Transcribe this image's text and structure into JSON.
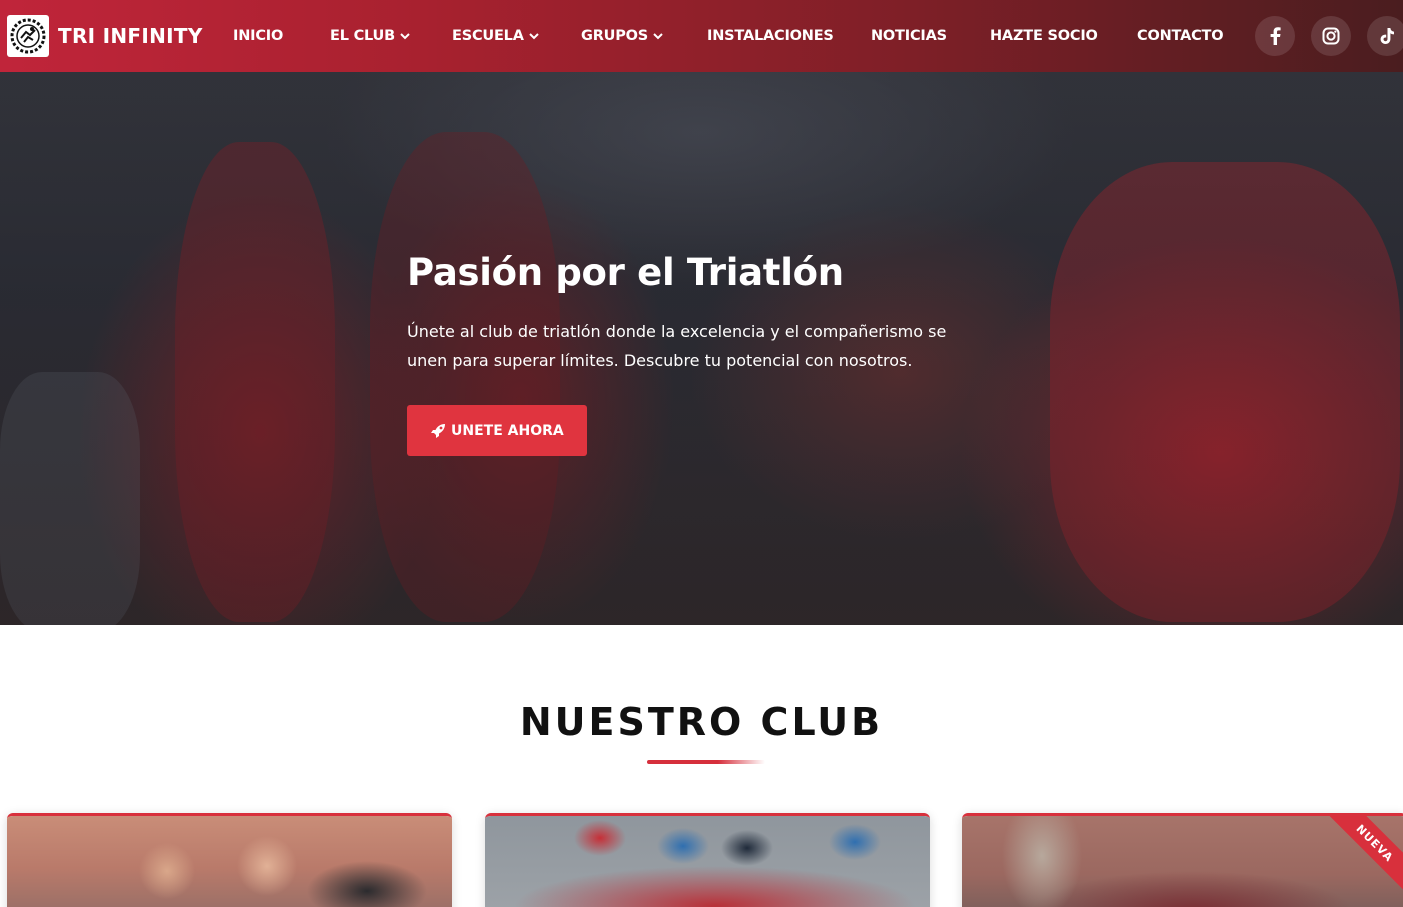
{
  "brand": {
    "name": "TRI INFINITY",
    "logo_icon": "triathlon-club-logo"
  },
  "nav": {
    "items": [
      {
        "label": "INICIO",
        "dropdown": false
      },
      {
        "label": "EL CLUB",
        "dropdown": true
      },
      {
        "label": "ESCUELA",
        "dropdown": true
      },
      {
        "label": "GRUPOS",
        "dropdown": true
      },
      {
        "label": "INSTALACIONES",
        "dropdown": false
      },
      {
        "label": "NOTICIAS",
        "dropdown": false
      },
      {
        "label": "HAZTE SOCIO",
        "dropdown": false
      },
      {
        "label": "CONTACTO",
        "dropdown": false
      }
    ],
    "social": [
      "facebook-icon",
      "instagram-icon",
      "tiktok-icon"
    ]
  },
  "hero": {
    "title": "Pasión por el Triatlón",
    "subtitle": "Únete al club de triatlón donde la excelencia y el compañerismo se unen para superar límites. Descubre tu potencial con nosotros.",
    "cta_label": "UNETE AHORA",
    "cta_icon": "rocket-icon"
  },
  "club_section": {
    "title": "NUESTRO CLUB",
    "cards": [
      {
        "image": "women-athletes-photo",
        "badge": ""
      },
      {
        "image": "cyclists-race-photo",
        "badge": ""
      },
      {
        "image": "runners-race-photo",
        "badge": "NUEVA"
      }
    ]
  },
  "colors": {
    "accent": "#e0343f",
    "nav_start": "#c0253a",
    "nav_end": "#4a1d1f"
  }
}
